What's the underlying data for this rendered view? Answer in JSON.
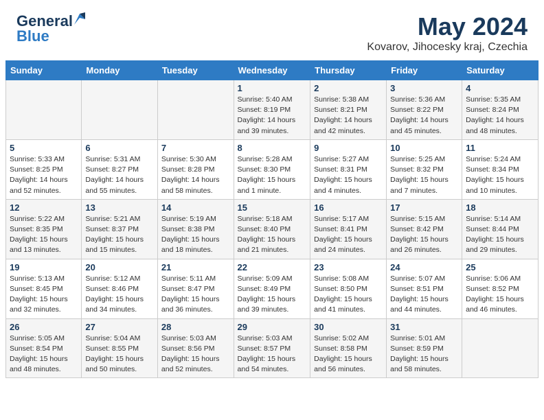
{
  "header": {
    "logo_general": "General",
    "logo_blue": "Blue",
    "month": "May 2024",
    "location": "Kovarov, Jihocesky kraj, Czechia"
  },
  "weekdays": [
    "Sunday",
    "Monday",
    "Tuesday",
    "Wednesday",
    "Thursday",
    "Friday",
    "Saturday"
  ],
  "weeks": [
    [
      {
        "day": "",
        "info": ""
      },
      {
        "day": "",
        "info": ""
      },
      {
        "day": "",
        "info": ""
      },
      {
        "day": "1",
        "info": "Sunrise: 5:40 AM\nSunset: 8:19 PM\nDaylight: 14 hours\nand 39 minutes."
      },
      {
        "day": "2",
        "info": "Sunrise: 5:38 AM\nSunset: 8:21 PM\nDaylight: 14 hours\nand 42 minutes."
      },
      {
        "day": "3",
        "info": "Sunrise: 5:36 AM\nSunset: 8:22 PM\nDaylight: 14 hours\nand 45 minutes."
      },
      {
        "day": "4",
        "info": "Sunrise: 5:35 AM\nSunset: 8:24 PM\nDaylight: 14 hours\nand 48 minutes."
      }
    ],
    [
      {
        "day": "5",
        "info": "Sunrise: 5:33 AM\nSunset: 8:25 PM\nDaylight: 14 hours\nand 52 minutes."
      },
      {
        "day": "6",
        "info": "Sunrise: 5:31 AM\nSunset: 8:27 PM\nDaylight: 14 hours\nand 55 minutes."
      },
      {
        "day": "7",
        "info": "Sunrise: 5:30 AM\nSunset: 8:28 PM\nDaylight: 14 hours\nand 58 minutes."
      },
      {
        "day": "8",
        "info": "Sunrise: 5:28 AM\nSunset: 8:30 PM\nDaylight: 15 hours\nand 1 minute."
      },
      {
        "day": "9",
        "info": "Sunrise: 5:27 AM\nSunset: 8:31 PM\nDaylight: 15 hours\nand 4 minutes."
      },
      {
        "day": "10",
        "info": "Sunrise: 5:25 AM\nSunset: 8:32 PM\nDaylight: 15 hours\nand 7 minutes."
      },
      {
        "day": "11",
        "info": "Sunrise: 5:24 AM\nSunset: 8:34 PM\nDaylight: 15 hours\nand 10 minutes."
      }
    ],
    [
      {
        "day": "12",
        "info": "Sunrise: 5:22 AM\nSunset: 8:35 PM\nDaylight: 15 hours\nand 13 minutes."
      },
      {
        "day": "13",
        "info": "Sunrise: 5:21 AM\nSunset: 8:37 PM\nDaylight: 15 hours\nand 15 minutes."
      },
      {
        "day": "14",
        "info": "Sunrise: 5:19 AM\nSunset: 8:38 PM\nDaylight: 15 hours\nand 18 minutes."
      },
      {
        "day": "15",
        "info": "Sunrise: 5:18 AM\nSunset: 8:40 PM\nDaylight: 15 hours\nand 21 minutes."
      },
      {
        "day": "16",
        "info": "Sunrise: 5:17 AM\nSunset: 8:41 PM\nDaylight: 15 hours\nand 24 minutes."
      },
      {
        "day": "17",
        "info": "Sunrise: 5:15 AM\nSunset: 8:42 PM\nDaylight: 15 hours\nand 26 minutes."
      },
      {
        "day": "18",
        "info": "Sunrise: 5:14 AM\nSunset: 8:44 PM\nDaylight: 15 hours\nand 29 minutes."
      }
    ],
    [
      {
        "day": "19",
        "info": "Sunrise: 5:13 AM\nSunset: 8:45 PM\nDaylight: 15 hours\nand 32 minutes."
      },
      {
        "day": "20",
        "info": "Sunrise: 5:12 AM\nSunset: 8:46 PM\nDaylight: 15 hours\nand 34 minutes."
      },
      {
        "day": "21",
        "info": "Sunrise: 5:11 AM\nSunset: 8:47 PM\nDaylight: 15 hours\nand 36 minutes."
      },
      {
        "day": "22",
        "info": "Sunrise: 5:09 AM\nSunset: 8:49 PM\nDaylight: 15 hours\nand 39 minutes."
      },
      {
        "day": "23",
        "info": "Sunrise: 5:08 AM\nSunset: 8:50 PM\nDaylight: 15 hours\nand 41 minutes."
      },
      {
        "day": "24",
        "info": "Sunrise: 5:07 AM\nSunset: 8:51 PM\nDaylight: 15 hours\nand 44 minutes."
      },
      {
        "day": "25",
        "info": "Sunrise: 5:06 AM\nSunset: 8:52 PM\nDaylight: 15 hours\nand 46 minutes."
      }
    ],
    [
      {
        "day": "26",
        "info": "Sunrise: 5:05 AM\nSunset: 8:54 PM\nDaylight: 15 hours\nand 48 minutes."
      },
      {
        "day": "27",
        "info": "Sunrise: 5:04 AM\nSunset: 8:55 PM\nDaylight: 15 hours\nand 50 minutes."
      },
      {
        "day": "28",
        "info": "Sunrise: 5:03 AM\nSunset: 8:56 PM\nDaylight: 15 hours\nand 52 minutes."
      },
      {
        "day": "29",
        "info": "Sunrise: 5:03 AM\nSunset: 8:57 PM\nDaylight: 15 hours\nand 54 minutes."
      },
      {
        "day": "30",
        "info": "Sunrise: 5:02 AM\nSunset: 8:58 PM\nDaylight: 15 hours\nand 56 minutes."
      },
      {
        "day": "31",
        "info": "Sunrise: 5:01 AM\nSunset: 8:59 PM\nDaylight: 15 hours\nand 58 minutes."
      },
      {
        "day": "",
        "info": ""
      }
    ]
  ]
}
